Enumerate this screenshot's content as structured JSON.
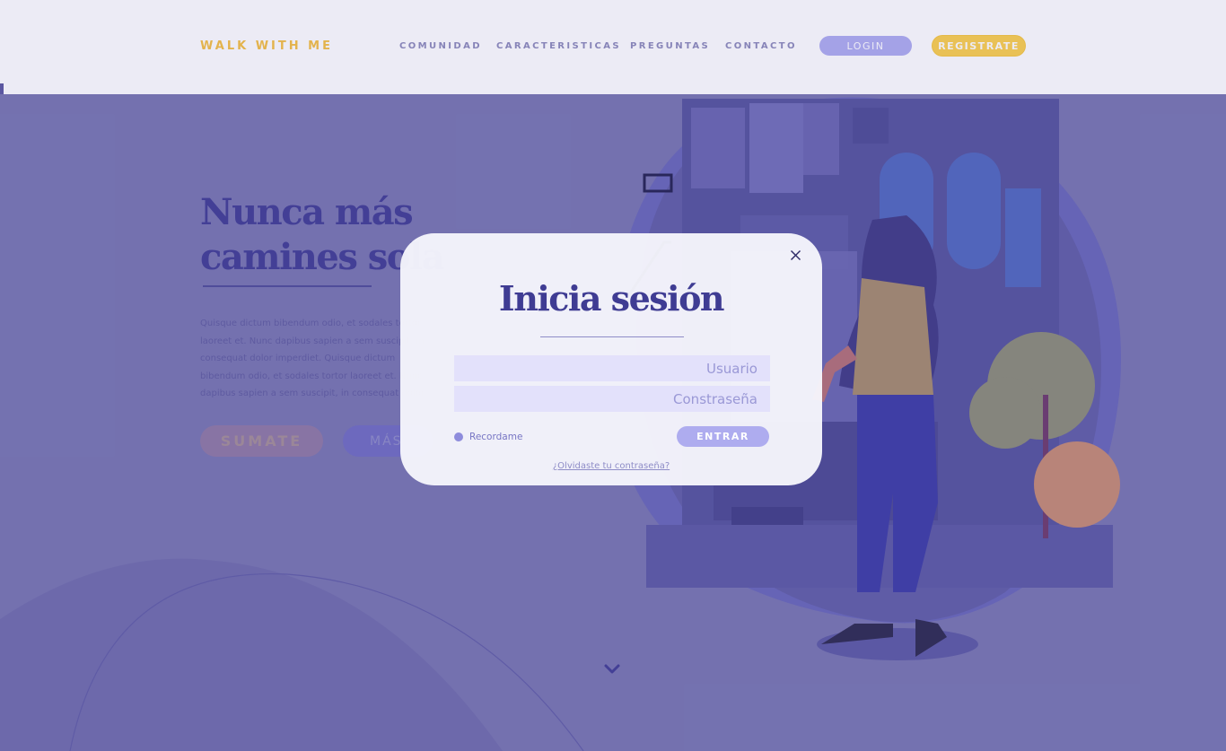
{
  "header": {
    "brand": "WALK WITH ME",
    "nav": [
      "COMUNIDAD",
      "CARACTERISTICAS",
      "PREGUNTAS",
      "CONTACTO"
    ],
    "login_label": "LOGIN",
    "register_label": "REGISTRATE"
  },
  "hero": {
    "title_line1": "Nunca más",
    "title_line2": "camines sola",
    "paragraph": "Quisque dictum bibendum odio, et sodales tortor laoreet et. Nunc dapibus sapien a sem suscipit, in consequat dolor imperdiet. Quisque dictum bibendum odio, et sodales tortor laoreet et. Nunc dapibus sapien a sem suscipit, in consequat dolor imperdiet.",
    "primary_button": "SUMATE",
    "secondary_button": "MÁS"
  },
  "modal": {
    "title": "Inicia sesión",
    "username_placeholder": "Usuario",
    "password_placeholder": "Constraseña",
    "remember_label": "Recordame",
    "submit_label": "ENTRAR",
    "forgot_link": "¿Olvidaste tu contraseña?"
  },
  "colors": {
    "brand_yellow": "#f5c040",
    "accent_purple": "#3f3c93",
    "soft_lilac": "#aeacef",
    "hero_background": "#7775b0"
  },
  "icons": {
    "close": "close-icon",
    "scroll": "chevron-down-icon"
  }
}
